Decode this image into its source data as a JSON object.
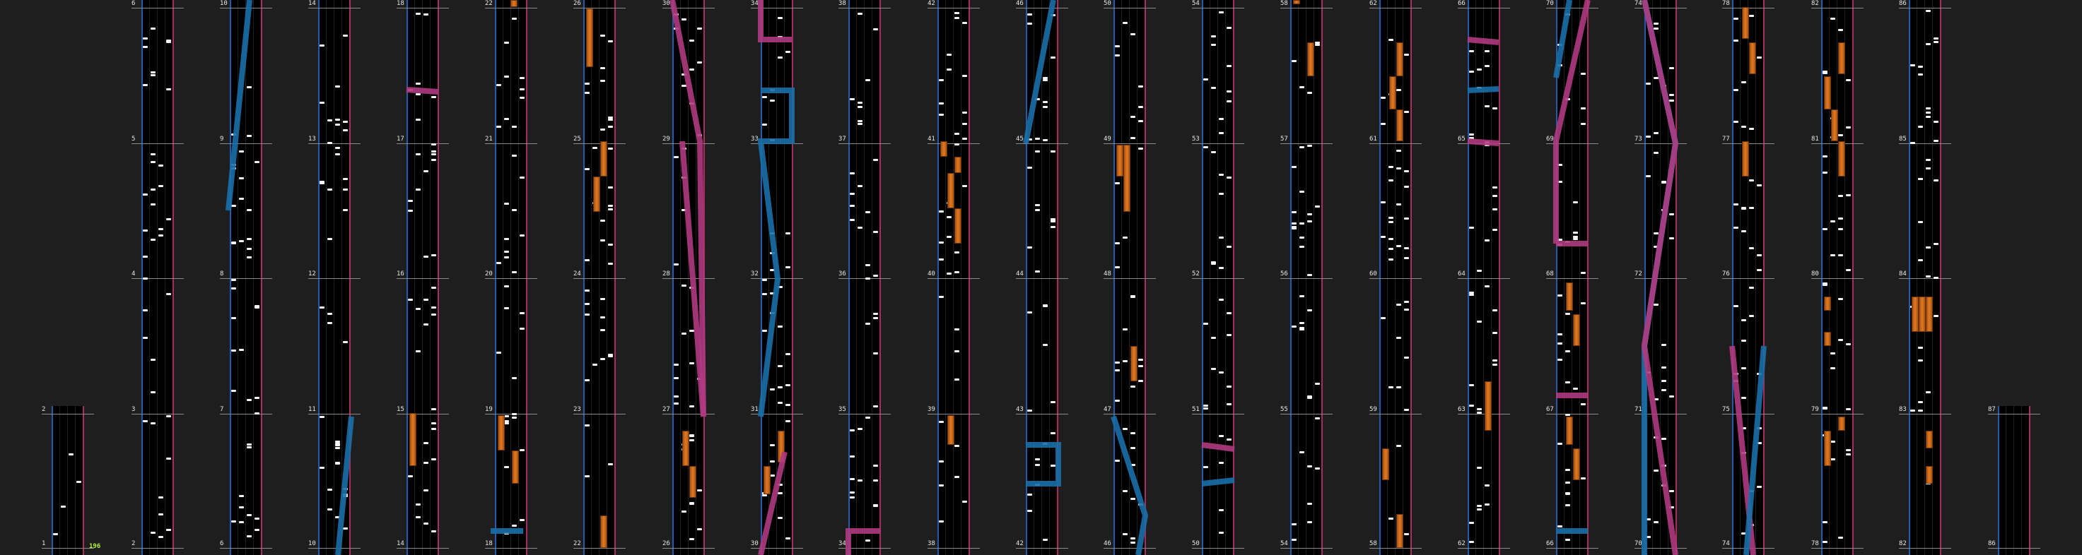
{
  "combo_label": "196",
  "colors": {
    "background": "#1e1e1e",
    "lane_bg": "#000000",
    "left_rail": "#2a6ac8",
    "right_rail": "#c8326e",
    "tap_note": "#f5f5f5",
    "hold_note": "#e17b24",
    "slide_blue": "#1a6fa8",
    "slide_pink": "#b03a82",
    "combo": "#b6f23a"
  },
  "columns": [
    {
      "bottom_row": [
        "1"
      ],
      "rows": [
        "2"
      ]
    },
    {
      "rows": [
        "2",
        "3",
        "4",
        "5",
        "6"
      ]
    },
    {
      "rows": [
        "6",
        "7",
        "8",
        "9",
        "10"
      ]
    },
    {
      "rows": [
        "10",
        "11",
        "12",
        "13",
        "14"
      ]
    },
    {
      "rows": [
        "14",
        "15",
        "16",
        "17",
        "18"
      ]
    },
    {
      "rows": [
        "18",
        "19",
        "20",
        "21",
        "22"
      ]
    },
    {
      "rows": [
        "22",
        "23",
        "24",
        "25",
        "26"
      ]
    },
    {
      "rows": [
        "26",
        "27",
        "28",
        "29",
        "30"
      ]
    },
    {
      "rows": [
        "30",
        "31",
        "32",
        "33",
        "34"
      ]
    },
    {
      "rows": [
        "34",
        "35",
        "36",
        "37",
        "38"
      ]
    },
    {
      "rows": [
        "38",
        "39",
        "40",
        "41",
        "42"
      ]
    },
    {
      "rows": [
        "42",
        "43",
        "44",
        "45",
        "46"
      ]
    },
    {
      "rows": [
        "46",
        "47",
        "48",
        "49",
        "50"
      ]
    },
    {
      "rows": [
        "50",
        "51",
        "52",
        "53",
        "54"
      ]
    },
    {
      "rows": [
        "54",
        "55",
        "56",
        "57",
        "58"
      ]
    },
    {
      "rows": [
        "58",
        "59",
        "60",
        "61",
        "62"
      ]
    },
    {
      "rows": [
        "62",
        "63",
        "64",
        "65",
        "66"
      ]
    },
    {
      "rows": [
        "66",
        "67",
        "68",
        "69",
        "70"
      ]
    },
    {
      "rows": [
        "70",
        "71",
        "72",
        "73",
        "74"
      ]
    },
    {
      "rows": [
        "74",
        "75",
        "76",
        "77",
        "78"
      ]
    },
    {
      "rows": [
        "78",
        "79",
        "80",
        "81",
        "82"
      ]
    },
    {
      "rows": [
        "82",
        "83",
        "84",
        "85",
        "86"
      ]
    },
    {
      "rows": [
        "86",
        "87"
      ]
    }
  ]
}
